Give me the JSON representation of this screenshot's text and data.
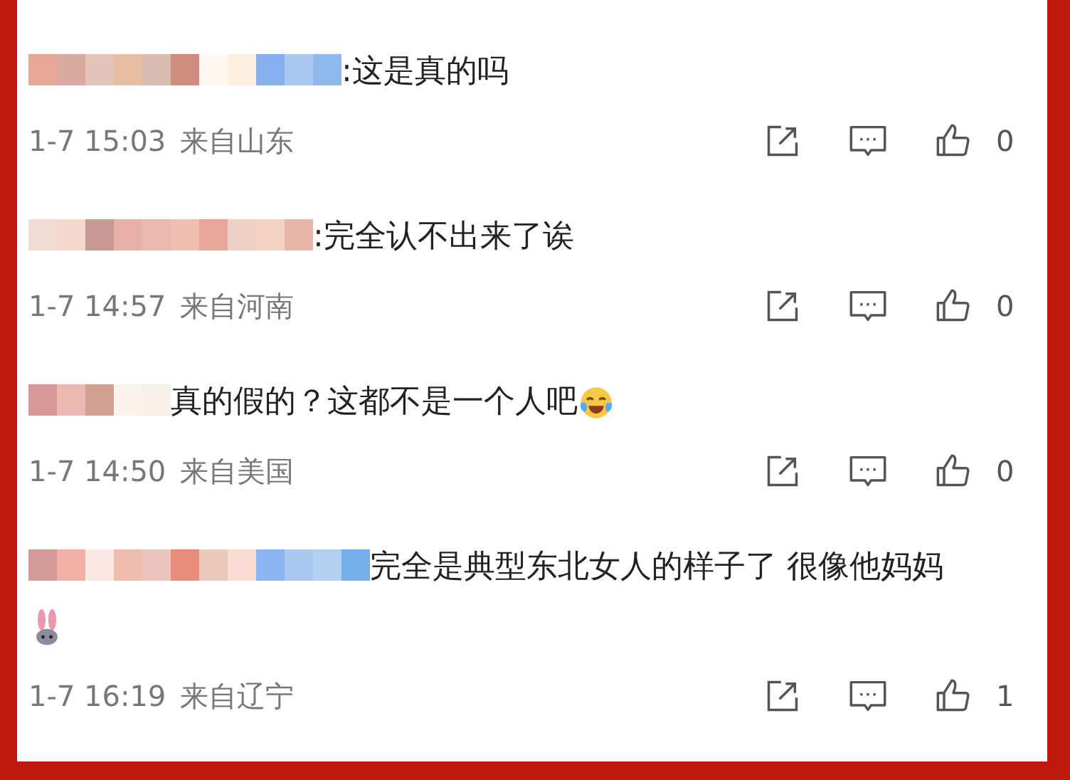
{
  "comments": [
    {
      "text": ":这是真的吗",
      "time": "1-7 15:03",
      "location": "来自山东",
      "likes": "0"
    },
    {
      "text": ":完全认不出来了诶",
      "time": "1-7 14:57",
      "location": "来自河南",
      "likes": "0"
    },
    {
      "text": "真的假的？这都不是一个人吧",
      "emoji": {
        "kind": "laughing"
      },
      "time": "1-7 14:50",
      "location": "来自美国",
      "likes": "0"
    },
    {
      "text": "完全是典型东北女人的样子了 很像他妈妈",
      "emoji": {
        "kind": "rabbit"
      },
      "time": "1-7 16:19",
      "location": "来自辽宁",
      "likes": "1"
    }
  ]
}
